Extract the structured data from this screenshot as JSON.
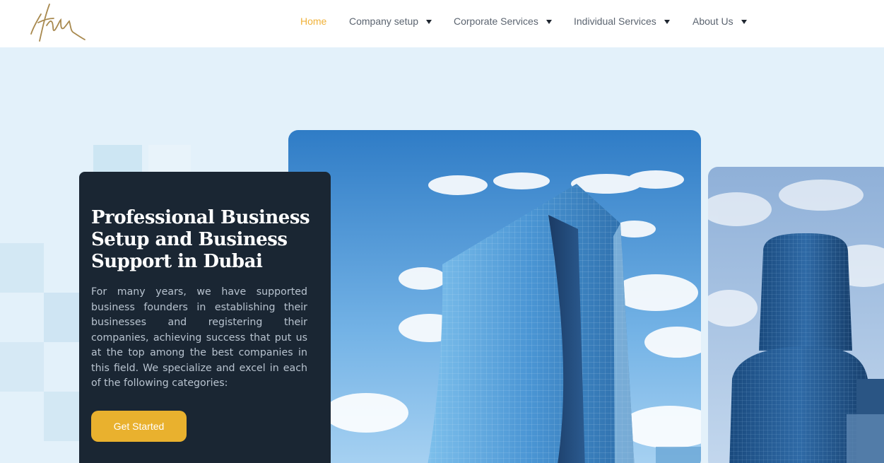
{
  "header": {
    "logo_text": "Hm",
    "nav": [
      {
        "label": "Home",
        "active": true,
        "has_dropdown": false
      },
      {
        "label": "Company setup",
        "active": false,
        "has_dropdown": true
      },
      {
        "label": "Corporate Services",
        "active": false,
        "has_dropdown": true
      },
      {
        "label": "Individual Services",
        "active": false,
        "has_dropdown": true
      },
      {
        "label": "About Us",
        "active": false,
        "has_dropdown": true
      }
    ]
  },
  "hero": {
    "title": "Professional Business Setup and Business Support in Dubai",
    "description": "For many years, we have supported business founders in establishing their businesses and registering their companies, achieving success that put us at the top among the best companies in this field. We specialize and excel in each of the following categories:",
    "cta_label": "Get Started"
  },
  "colors": {
    "accent": "#f0b23a",
    "button": "#e9b12e",
    "card_bg": "#1a2633",
    "page_bg": "#e3f1fa"
  },
  "icons": [
    "chevron-down-icon"
  ]
}
